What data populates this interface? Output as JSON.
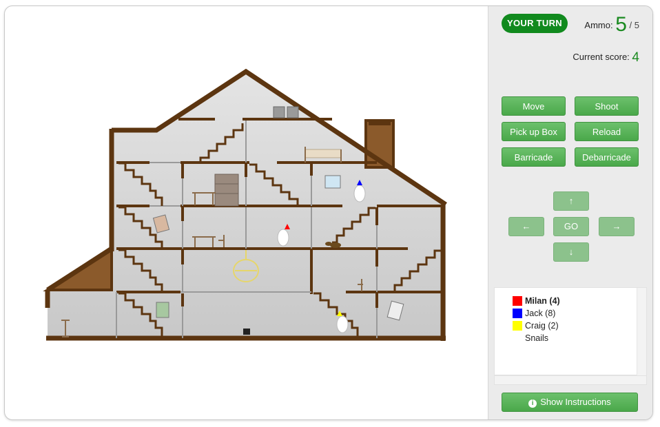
{
  "status": {
    "turn_label": "YOUR TURN"
  },
  "ammo": {
    "label": "Ammo:",
    "current": "5",
    "max": "/ 5"
  },
  "score": {
    "label": "Current score:",
    "value": "4"
  },
  "actions": {
    "move": "Move",
    "shoot": "Shoot",
    "pickup": "Pick up Box",
    "reload": "Reload",
    "barricade": "Barricade",
    "debarricade": "Debarricade"
  },
  "dpad": {
    "up": "↑",
    "left": "←",
    "go": "GO",
    "right": "→",
    "down": "↓"
  },
  "players": [
    {
      "name": "Milan (4)",
      "color": "#ff0000"
    },
    {
      "name": "Jack (8)",
      "color": "#0000ff"
    },
    {
      "name": "Craig (2)",
      "color": "#ffff00"
    },
    {
      "name": "Snails",
      "color": ""
    }
  ],
  "instructions_label": "Show Instructions",
  "colors": {
    "wall": "#5c3510",
    "room": "#cfcfcf",
    "accent_green": "#1a8a20"
  }
}
